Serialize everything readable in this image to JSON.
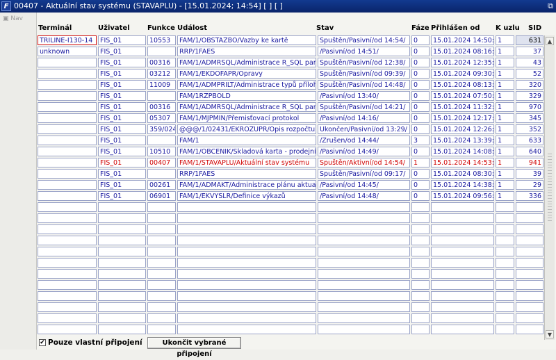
{
  "window": {
    "title": "00407 - Aktuální stav systému (STAVAPLU) - [15.01.2024; 14:54] [ ] [ ]",
    "logo_text": "F",
    "restore_icon": "restore-icon"
  },
  "nav": {
    "label": "Nav"
  },
  "columns": [
    {
      "key": "terminal",
      "label": "Terminál"
    },
    {
      "key": "user",
      "label": "Uživatel"
    },
    {
      "key": "func",
      "label": "Funkce"
    },
    {
      "key": "event",
      "label": "Událost"
    },
    {
      "key": "state",
      "label": "Stav"
    },
    {
      "key": "phase",
      "label": "Fáze"
    },
    {
      "key": "login",
      "label": "Přihlášen od"
    },
    {
      "key": "node",
      "label": "K uzlu"
    },
    {
      "key": "sid",
      "label": "SID"
    }
  ],
  "rows": [
    {
      "terminal": "TRILINE-I130-14",
      "user": "FIS_01",
      "func": "10553",
      "event": "FAM/1/OBSTAZBO/Vazby ke kartě",
      "state": "Spuštěn/Pasivní/od 14:54/",
      "phase": "0",
      "login": "15.01.2024 14:50:23",
      "node": "1",
      "sid": "631"
    },
    {
      "terminal": "unknown",
      "user": "FIS_01",
      "func": "",
      "event": "RRP/1FAES",
      "state": "/Pasivní/od 14:51/",
      "phase": "0",
      "login": "15.01.2024 08:16:25",
      "node": "1",
      "sid": "37"
    },
    {
      "terminal": "",
      "user": "FIS_01",
      "func": "00316",
      "event": "FAM/1/ADMRSQL/Administrace R_SQL parametrů",
      "state": "Spuštěn/Pasivní/od 12:38/",
      "phase": "0",
      "login": "15.01.2024 12:35:11",
      "node": "1",
      "sid": "43"
    },
    {
      "terminal": "",
      "user": "FIS_01",
      "func": "03212",
      "event": "FAM/1/EKDOFAPR/Opravy",
      "state": "Spuštěn/Pasivní/od 09:39/",
      "phase": "0",
      "login": "15.01.2024 09:30:47",
      "node": "1",
      "sid": "52"
    },
    {
      "terminal": "",
      "user": "FIS_01",
      "func": "11009",
      "event": "FAM/1/ADMPRILT/Administrace typů příloh",
      "state": "Spuštěn/Pasivní/od 14:48/",
      "phase": "0",
      "login": "15.01.2024 08:13:10",
      "node": "1",
      "sid": "320"
    },
    {
      "terminal": "",
      "user": "FIS_01",
      "func": "",
      "event": "FAM/1RZPBOLD",
      "state": "/Pasivní/od 13:40/",
      "phase": "0",
      "login": "15.01.2024 07:50:47",
      "node": "1",
      "sid": "329"
    },
    {
      "terminal": "",
      "user": "FIS_01",
      "func": "00316",
      "event": "FAM/1/ADMRSQL/Administrace R_SQL parametrů",
      "state": "Spuštěn/Pasivní/od 14:21/",
      "phase": "0",
      "login": "15.01.2024 11:32:04",
      "node": "1",
      "sid": "970"
    },
    {
      "terminal": "",
      "user": "FIS_01",
      "func": "05307",
      "event": "FAM/1/MJPMIN/Přemisťovací protokol",
      "state": "/Pasivní/od 14:16/",
      "phase": "0",
      "login": "15.01.2024 12:17:57",
      "node": "1",
      "sid": "345"
    },
    {
      "terminal": "",
      "user": "FIS_01",
      "func": "359/02431",
      "event": "@@@/1/02431/EKROZUPR/Opis rozpočtu",
      "state": "Ukončen/Pasivní/od 13:29/",
      "phase": "0",
      "login": "15.01.2024 12:26:17",
      "node": "1",
      "sid": "352"
    },
    {
      "terminal": "",
      "user": "FIS_01",
      "func": "",
      "event": "FAM/1",
      "state": "/Zrušen/od 14:44/",
      "phase": "3",
      "login": "15.01.2024 13:39:33",
      "node": "1",
      "sid": "633"
    },
    {
      "terminal": "",
      "user": "FIS_01",
      "func": "10510",
      "event": "FAM/1/OBCENIK/Skladová karta - prodejní ceník",
      "state": "/Pasivní/od 14:49/",
      "phase": "0",
      "login": "15.01.2024 14:08:26",
      "node": "1",
      "sid": "640"
    },
    {
      "terminal": "",
      "user": "FIS_01",
      "func": "00407",
      "event": "FAM/1/STAVAPLU/Aktuální stav systému",
      "state": "Spuštěn/Aktivní/od 14:54/",
      "phase": "1",
      "login": "15.01.2024 14:53:32",
      "node": "1",
      "sid": "941",
      "active": true
    },
    {
      "terminal": "",
      "user": "FIS_01",
      "func": "",
      "event": "RRP/1FAES",
      "state": "Spuštěn/Pasivní/od 09:17/",
      "phase": "0",
      "login": "15.01.2024 08:30:50",
      "node": "1",
      "sid": "39"
    },
    {
      "terminal": "",
      "user": "FIS_01",
      "func": "00261",
      "event": "FAM/1/ADMAKT/Administrace plánu aktualizací test",
      "state": "/Pasivní/od 14:45/",
      "phase": "0",
      "login": "15.01.2024 14:38:04",
      "node": "1",
      "sid": "29"
    },
    {
      "terminal": "",
      "user": "FIS_01",
      "func": "06901",
      "event": "FAM/1/EKVYSLR/Definice výkazů",
      "state": "/Pasivní/od 14:48/",
      "phase": "0",
      "login": "15.01.2024 09:56:38",
      "node": "1",
      "sid": "336"
    }
  ],
  "empty_rows": 12,
  "footer": {
    "checkbox_label": "Pouze vlastní připojení",
    "checkbox_checked": true,
    "checkbox_mark": "✔",
    "end_button": "Ukončit vybrané připojení"
  },
  "colors": {
    "text": "#1a1aa0",
    "active_row": "#d00000",
    "titlebar": "#0a246a"
  }
}
